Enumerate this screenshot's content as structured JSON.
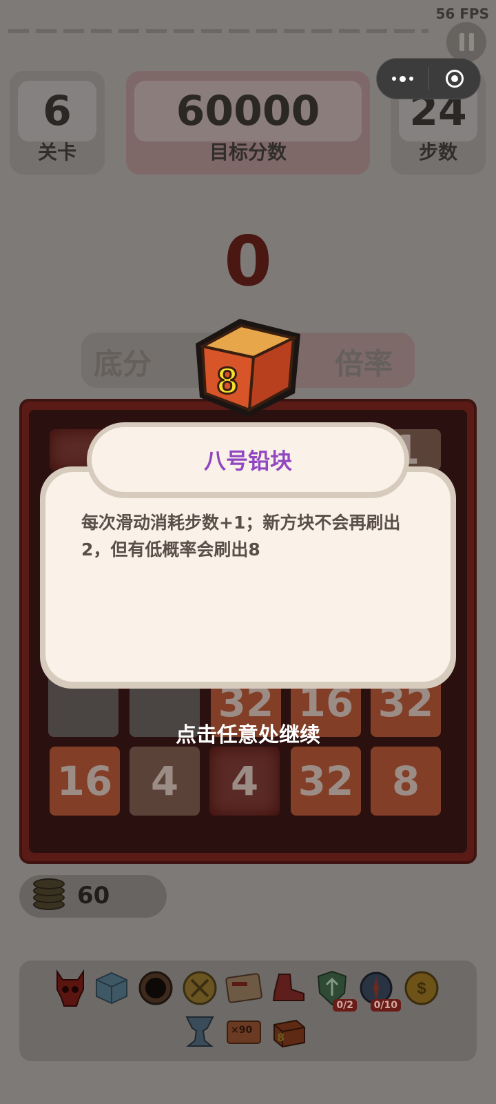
{
  "hud": {
    "fps": "56 FPS",
    "level_value": "6",
    "level_label": "关卡",
    "target_value": "60000",
    "target_label": "目标分数",
    "steps_value": "24",
    "steps_label": "步数"
  },
  "score": "0",
  "ribbon": {
    "left_text": "底分",
    "right_text": "倍率"
  },
  "board": {
    "row4": [
      "",
      "",
      "32",
      "16",
      "32"
    ],
    "row5": [
      "16",
      "4",
      "4",
      "32",
      "8"
    ],
    "partial_top": [
      "",
      "",
      "",
      "",
      "1"
    ]
  },
  "coins": "60",
  "modal": {
    "block_number": "8",
    "title": "八号铅块",
    "description": "每次滑动消耗步数+1；新方块不会再刷出2，但有低概率会刷出8",
    "continue_hint": "点击任意处继续"
  },
  "items": [
    {
      "icon": "demon-skull-icon"
    },
    {
      "icon": "ice-cube-icon"
    },
    {
      "icon": "black-hole-icon"
    },
    {
      "icon": "crossed-swords-coin-icon"
    },
    {
      "icon": "money-card-icon"
    },
    {
      "icon": "red-boot-icon"
    },
    {
      "icon": "shield-arrow-icon",
      "badge": "0/2"
    },
    {
      "icon": "compass-icon",
      "badge": "0/10"
    },
    {
      "icon": "gold-coin-icon"
    },
    {
      "icon": "anvil-icon"
    },
    {
      "icon": "multiplier-card-icon",
      "label": "×90"
    },
    {
      "icon": "lead-block-icon",
      "label": "8"
    }
  ],
  "colors": {
    "title_purple": "#9147c2",
    "lead_orange": "#e0652c",
    "board_red": "#5a1a16"
  }
}
